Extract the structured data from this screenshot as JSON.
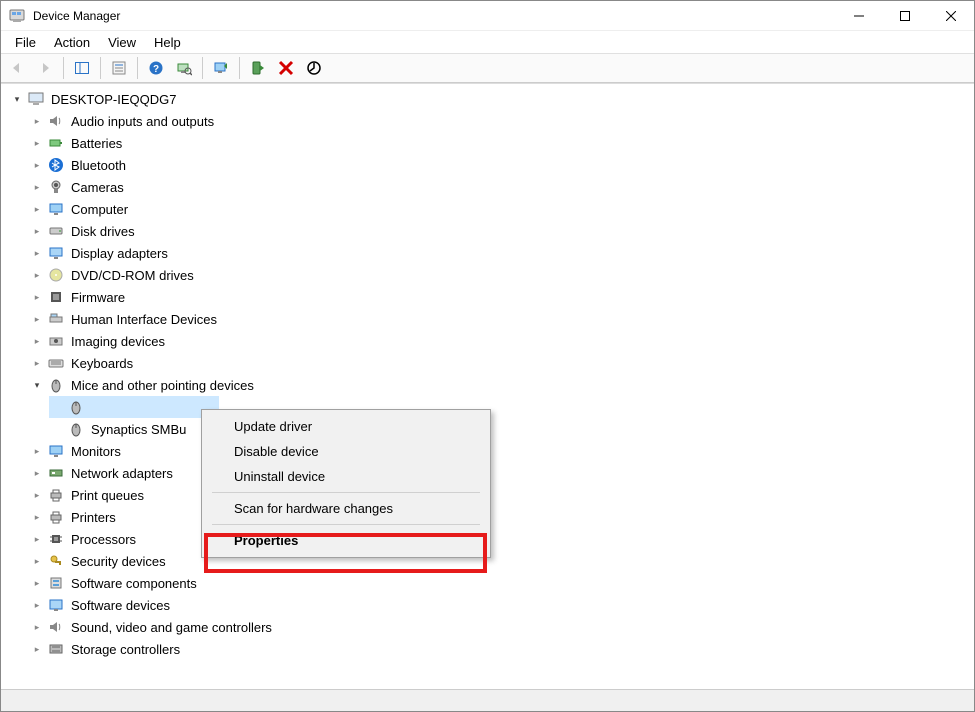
{
  "window": {
    "title": "Device Manager"
  },
  "menu": {
    "file": "File",
    "action": "Action",
    "view": "View",
    "help": "Help"
  },
  "tree": {
    "root": "DESKTOP-IEQQDG7",
    "audio": "Audio inputs and outputs",
    "batteries": "Batteries",
    "bluetooth": "Bluetooth",
    "cameras": "Cameras",
    "computer": "Computer",
    "disk": "Disk drives",
    "display": "Display adapters",
    "dvd": "DVD/CD-ROM drives",
    "firmware": "Firmware",
    "hid": "Human Interface Devices",
    "imaging": "Imaging devices",
    "keyboards": "Keyboards",
    "mice": "Mice and other pointing devices",
    "mouse_hid": "",
    "mouse_syn_partial": "Synaptics SMBu",
    "monitors": "Monitors",
    "network": "Network adapters",
    "printq": "Print queues",
    "printers": "Printers",
    "processors": "Processors",
    "security": "Security devices",
    "swcomp": "Software components",
    "swdev": "Software devices",
    "sound": "Sound, video and game controllers",
    "storage": "Storage controllers"
  },
  "context_menu": {
    "update": "Update driver",
    "disable": "Disable device",
    "uninstall": "Uninstall device",
    "scan": "Scan for hardware changes",
    "properties": "Properties"
  }
}
